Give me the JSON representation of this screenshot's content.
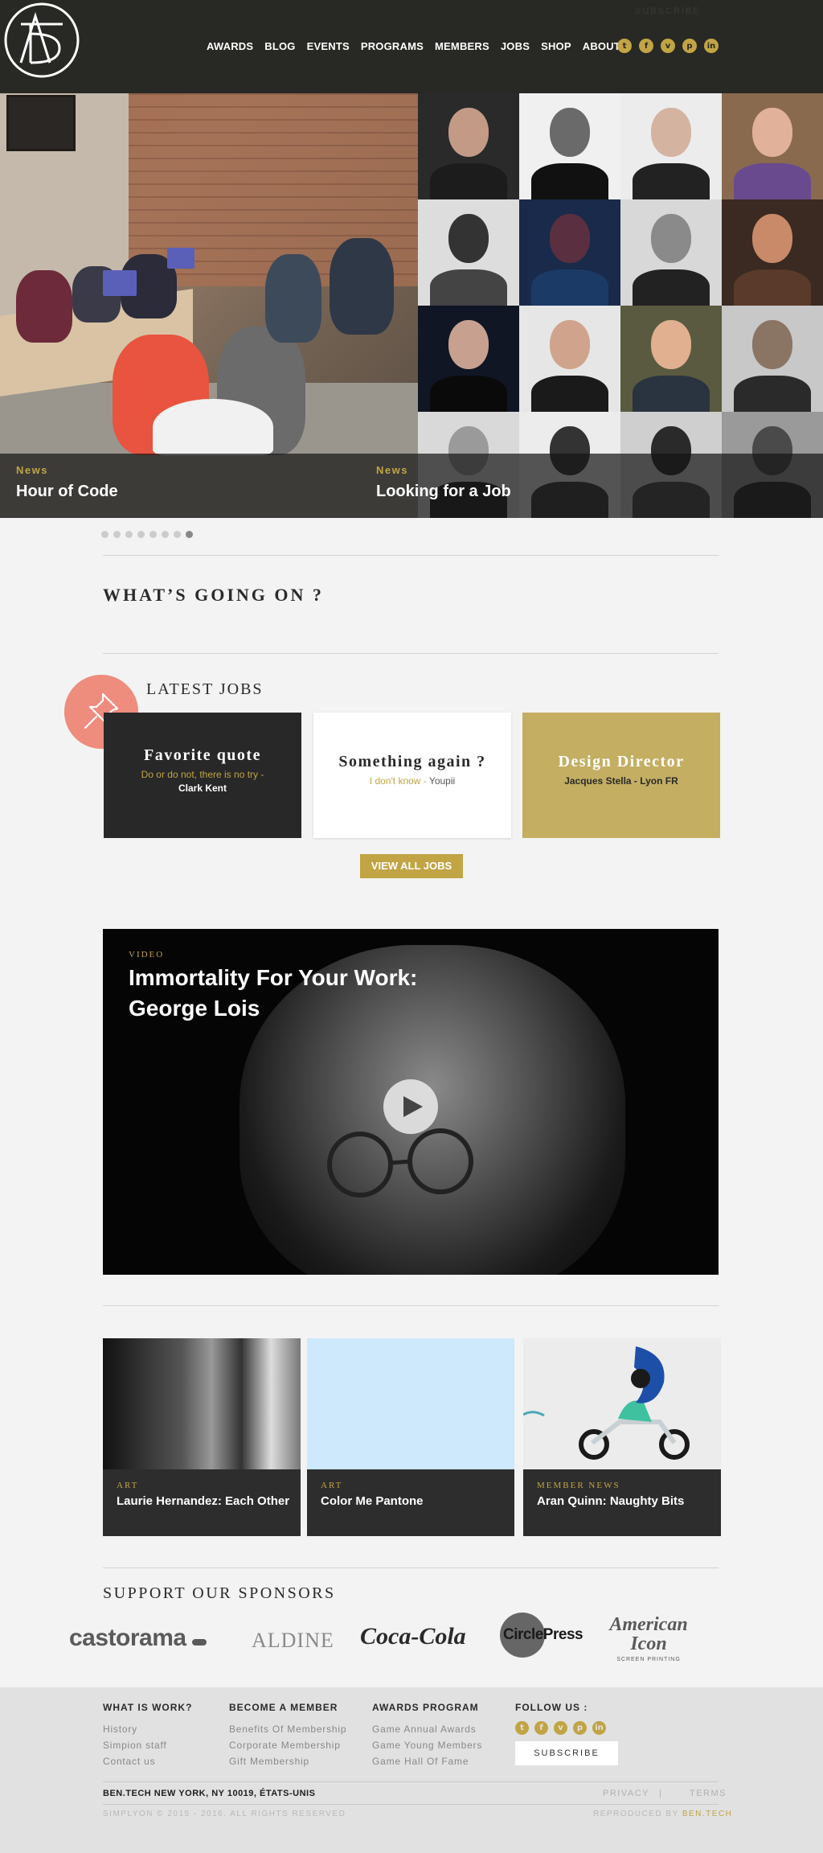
{
  "header": {
    "subscribe": "SUBSCRIBE",
    "nav": [
      "AWARDS",
      "BLOG",
      "EVENTS",
      "PROGRAMS",
      "MEMBERS",
      "JOBS",
      "SHOP",
      "ABOUT"
    ],
    "social": [
      {
        "icon": "twitter-icon",
        "glyph": "t"
      },
      {
        "icon": "facebook-icon",
        "glyph": "f"
      },
      {
        "icon": "vimeo-icon",
        "glyph": "v"
      },
      {
        "icon": "pinterest-icon",
        "glyph": "p"
      },
      {
        "icon": "linkedin-icon",
        "glyph": "in"
      }
    ]
  },
  "hero": {
    "slides": [
      {
        "tag": "News",
        "title": "Hour of Code"
      },
      {
        "tag": "News",
        "title": "Looking for a Job"
      }
    ],
    "dot_count": 8,
    "active_dot": 7
  },
  "going_on": {
    "title": "WHAT’S GOING ON ?"
  },
  "jobs": {
    "title": "LATEST JOBS",
    "cards": [
      {
        "title": "Favorite quote",
        "highlight": "Do or do not, there is no try - ",
        "detail": "Clark Kent"
      },
      {
        "title": "Something again ?",
        "highlight": "I don't know - ",
        "detail": "Youpii"
      },
      {
        "title": "Design Director",
        "highlight": "",
        "detail": "Jacques Stella - Lyon FR"
      }
    ],
    "view_all": "VIEW ALL JOBS"
  },
  "video": {
    "tag": "VIDEO",
    "title": "Immortality For Your Work: George Lois"
  },
  "articles": [
    {
      "tag": "ART",
      "title": "Laurie Hernandez: Each Other"
    },
    {
      "tag": "ART",
      "title": "Color Me Pantone"
    },
    {
      "tag": "MEMBER NEWS",
      "title": "Aran Quinn: Naughty Bits"
    }
  ],
  "sponsors": {
    "title": "SUPPORT OUR SPONSORS",
    "logos": [
      "castorama",
      "ALDINE",
      "Coca-Cola",
      "CirclePress",
      "American Icon",
      "SCREEN PRINTING"
    ]
  },
  "footer": {
    "columns": [
      {
        "title": "WHAT IS WORK?",
        "links": [
          "History",
          "Simpion staff",
          "Contact us"
        ]
      },
      {
        "title": "BECOME A MEMBER",
        "links": [
          "Benefits Of Membership",
          "Corporate Membership",
          "Gift Membership"
        ]
      },
      {
        "title": "AWARDS PROGRAM",
        "links": [
          "Game Annual Awards",
          "Game Young Members",
          "Game Hall Of Fame"
        ]
      }
    ],
    "follow_title": "FOLLOW US :",
    "subscribe": "SUBSCRIBE",
    "address": "BEN.TECH NEW YORK, NY 10019, ÉTATS-UNIS",
    "privacy": "PRIVACY",
    "separator": "|",
    "terms": "TERMS",
    "copyright": "SIMPLYON © 2015 - 2016. ALL RIGHTS RESERVED",
    "reproduced_by": "REPRODUCED BY",
    "reproduced_name": "BEN.TECH"
  },
  "colors": {
    "accent": "#c1a444",
    "dark": "#282824",
    "pin": "#ee8c7e"
  }
}
